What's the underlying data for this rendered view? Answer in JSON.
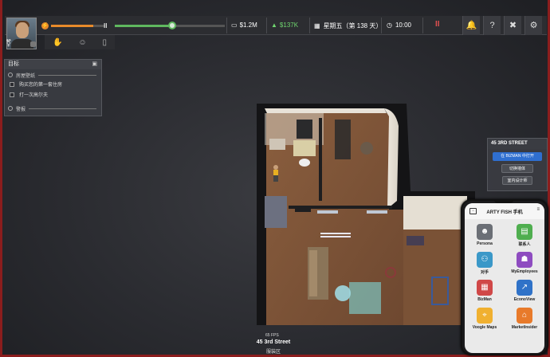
{
  "hud": {
    "money": "$1.2M",
    "income": "$137K",
    "date": "星期五（第 138 天）",
    "time": "10:00",
    "energy_level": 0.78,
    "speed_level": 0.52,
    "icons": [
      "bell-icon",
      "question-icon",
      "no-tools-icon",
      "gear-icon"
    ]
  },
  "objectives": {
    "title": "目标",
    "section1": "房屋壁纸",
    "tasks": [
      "购买您的第一套住房",
      "打一次高尔夫"
    ],
    "section2": "警报"
  },
  "location": {
    "fps": "65 FPS",
    "address": "45 3rd Street",
    "district": "服装区"
  },
  "building_panel": {
    "title": "45 3RD STREET",
    "open_btn": "在 BIZMAN 中打开",
    "wall_btn": "切换墙体",
    "interior_btn": "室内设计师"
  },
  "phone": {
    "title": "ARTY FISH 手机",
    "apps": [
      {
        "label": "Persona",
        "icon": "persona-icon",
        "color": "#6b6f76"
      },
      {
        "label": "联系人",
        "icon": "contacts-icon",
        "color": "#4fae4f"
      },
      {
        "label": "对手",
        "icon": "rivals-icon",
        "color": "#3b98c8"
      },
      {
        "label": "MyEmployees",
        "icon": "employees-icon",
        "color": "#8e4cc0"
      },
      {
        "label": "BizMan",
        "icon": "bizman-icon",
        "color": "#d04848"
      },
      {
        "label": "EconoView",
        "icon": "econoview-icon",
        "color": "#2f72c8"
      },
      {
        "label": "Voogle Maps",
        "icon": "maps-icon",
        "color": "#f0b030"
      },
      {
        "label": "MarketInsider",
        "icon": "marketinsider-icon",
        "color": "#e87a2a"
      }
    ]
  }
}
